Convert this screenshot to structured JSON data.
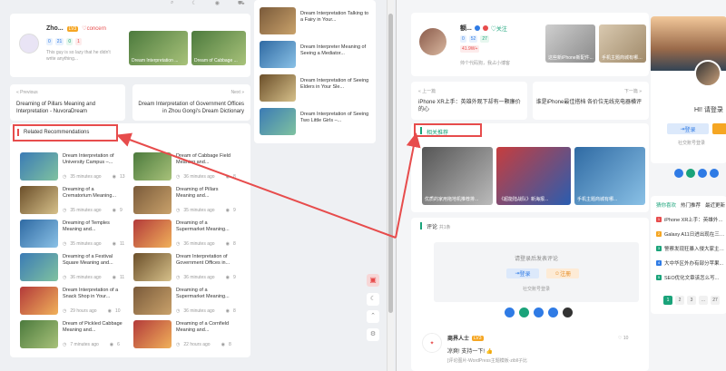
{
  "left": {
    "profile": {
      "name": "Zho...",
      "level": "LV3",
      "concern": "concern",
      "stats": [
        "0",
        "21",
        "0",
        "1"
      ],
      "bio": "This guy is so lazy that he didn't write anything...",
      "thumbs": [
        "Dream Interpretation ...",
        "Dream of Cabbage ..."
      ]
    },
    "prev": {
      "label": "Previous",
      "title": "Dreaming of Pillars Meaning and Interpretation - NuvoraDream"
    },
    "next": {
      "label": "Next",
      "title": "Dream Interpretation of Government Offices in Zhou Gongi's Dream Dictionary"
    },
    "related_title": "Related Recommendations",
    "items": [
      {
        "title": "Dream Interpretation of University Campus –...",
        "time": "35 minutes ago",
        "views": "13"
      },
      {
        "title": "Dream of Cabbage Field Meaning and...",
        "time": "36 minutes ago",
        "views": "8"
      },
      {
        "title": "Dreaming of a Crematorium Meaning...",
        "time": "35 minutes ago",
        "views": "9"
      },
      {
        "title": "Dreaming of Pillars Meaning and...",
        "time": "35 minutes ago",
        "views": "9"
      },
      {
        "title": "Dreaming of Temples Meaning and...",
        "time": "35 minutes ago",
        "views": "11"
      },
      {
        "title": "Dreaming of a Supermarket Meaning...",
        "time": "36 minutes ago",
        "views": "8"
      },
      {
        "title": "Dreaming of a Festival Square Meaning and...",
        "time": "36 minutes ago",
        "views": "11"
      },
      {
        "title": "Dream Interpretation of Government Offices in...",
        "time": "36 minutes ago",
        "views": "9"
      },
      {
        "title": "Dream Interpretation of a Snack Shop in Your...",
        "time": "29 hours ago",
        "views": "10"
      },
      {
        "title": "Dreaming of a Supermarket Meaning...",
        "time": "36 minutes ago",
        "views": "8"
      },
      {
        "title": "Dream of Pickled Cabbage Meaning and...",
        "time": "7 minutes ago",
        "views": "6"
      },
      {
        "title": "Dreaming of a Cornfield Meaning and...",
        "time": "22 hours ago",
        "views": "8"
      }
    ],
    "side_items": [
      "Dream Interpretation Talking to a Fairy in Your...",
      "Dream Interpreter Meaning of Seeing a Mediator...",
      "Dream Interpretation of Seeing Elders in Your Sle...",
      "Dream Interpretation of Seeing Two Little Girls –..."
    ]
  },
  "right": {
    "profile": {
      "name": "额...",
      "follow": "关注",
      "stats": [
        "0",
        "52",
        "27",
        "41.9W+"
      ],
      "bio": "帅个代码狗，我占小博客",
      "thumbs": [
        "这些新iPhone新配件...",
        "手机主题商城有哪些..."
      ]
    },
    "prev": {
      "label": "上一篇",
      "title": "iPhone XR上手：英雄外观下却有一颗廉价的心"
    },
    "next": {
      "label": "下一篇",
      "title": "谁是iPhone最佳搭档 各价位无线充电器横评"
    },
    "related_title": "相关推荐",
    "big_thumbs": [
      "优质的家用拖地机推荐排...",
      "《超能陆战队》新海报...",
      "手机主题商城有哪..."
    ],
    "comment_title": "评论",
    "comment_count": "共1条",
    "comment_prompt": "请登录后发表评论",
    "login": "登录",
    "register": "注册",
    "social_login": "社交账号登录",
    "commenter": {
      "name": "商界人士",
      "level": "LV3",
      "text": "凉爽! 支持一下!",
      "likes": "10",
      "img": "[评论图片-WordPress主题模板-zibll子比"
    },
    "sidebar": {
      "greeting": "HI! 请登录",
      "login": "登录",
      "social_login": "社交账号登录",
      "tabs": [
        "猜你喜欢",
        "热门推荐",
        "最近更新"
      ],
      "list": [
        "iPhone XR上手：英雄外观...",
        "Galaxy A11日进出现在三星...",
        "警察发现狂暴入侵大家主题...",
        "大中华区外办有部分苹果...",
        "SEO优化文章该怎么写..."
      ],
      "pages": [
        "1",
        "2",
        "3",
        "...",
        "27"
      ]
    }
  },
  "colors": {
    "accent_red": "#e74c4c",
    "green": "#1aa37a",
    "blue": "#2f7be5"
  }
}
